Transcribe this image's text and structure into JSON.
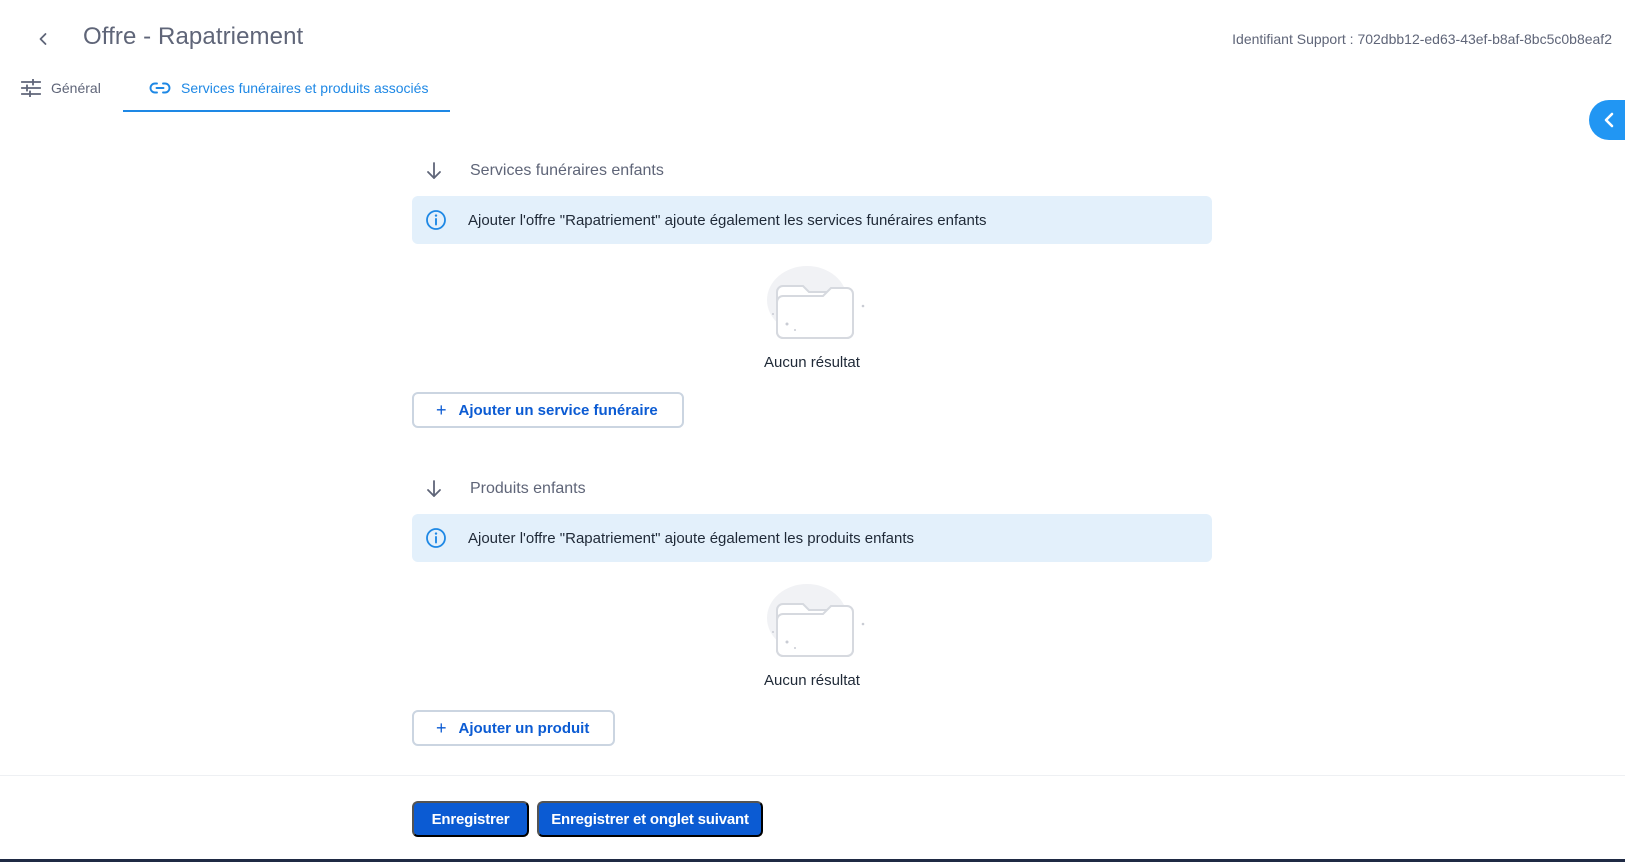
{
  "header": {
    "title": "Offre - Rapatriement",
    "support_id": "Identifiant Support : 702dbb12-ed63-43ef-b8af-8bc5c0b8eaf2"
  },
  "tabs": [
    {
      "label": "Général",
      "icon": "sliders-icon",
      "active": false
    },
    {
      "label": "Services funéraires et produits associés",
      "icon": "link-icon",
      "active": true
    }
  ],
  "sections": [
    {
      "title": "Services funéraires enfants",
      "info": "Ajouter l'offre \"Rapatriement\" ajoute également les services funéraires enfants",
      "empty_text": "Aucun résultat",
      "add_button": "Ajouter un service funéraire"
    },
    {
      "title": "Produits enfants",
      "info": "Ajouter l'offre \"Rapatriement\" ajoute également les produits enfants",
      "empty_text": "Aucun résultat",
      "add_button": "Ajouter un produit"
    }
  ],
  "footer": {
    "save_label": "Enregistrer",
    "save_next_label": "Enregistrer et onglet suivant"
  },
  "colors": {
    "accent": "#1e88e5",
    "primary_button": "#0b5bd3",
    "info_background": "#e3f0fb"
  }
}
